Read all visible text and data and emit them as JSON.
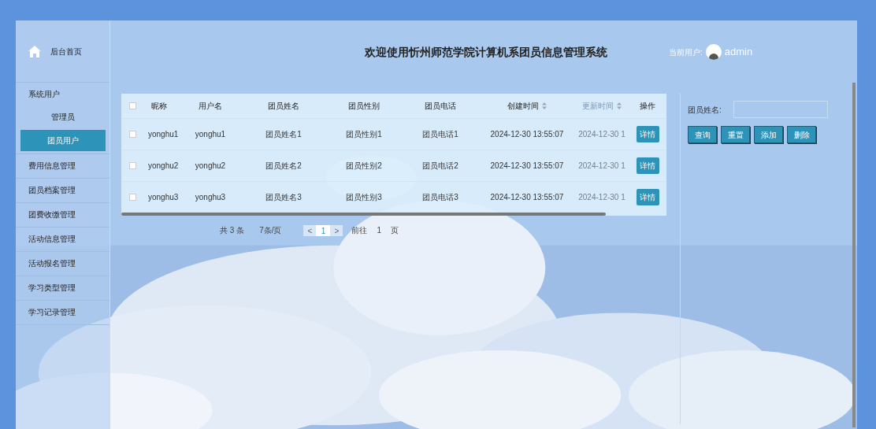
{
  "sidebar": {
    "home": {
      "label": "后台首页"
    },
    "items": [
      {
        "label": "系统用户",
        "selected": false,
        "children": [
          {
            "label": "管理员",
            "selected": false
          },
          {
            "label": "团员用户",
            "selected": true
          }
        ]
      },
      {
        "label": "费用信息管理",
        "selected": false
      },
      {
        "label": "团员档案管理",
        "selected": false
      },
      {
        "label": "团费收缴管理",
        "selected": false
      },
      {
        "label": "活动信息管理",
        "selected": false
      },
      {
        "label": "活动报名管理",
        "selected": false
      },
      {
        "label": "学习类型管理",
        "selected": false
      },
      {
        "label": "学习记录管理",
        "selected": false
      }
    ]
  },
  "header": {
    "title": "欢迎使用忻州师范学院计算机系团员信息管理系统",
    "user_label": "当前用户:",
    "username": "admin"
  },
  "table": {
    "select_all_checked": false,
    "columns": [
      {
        "label": "昵称",
        "sortable": false,
        "faded": false
      },
      {
        "label": "用户名",
        "sortable": false,
        "faded": false
      },
      {
        "label": "团员姓名",
        "sortable": false,
        "faded": false
      },
      {
        "label": "团员性别",
        "sortable": false,
        "faded": false
      },
      {
        "label": "团员电话",
        "sortable": false,
        "faded": false
      },
      {
        "label": "创建时间",
        "sortable": true,
        "faded": false
      },
      {
        "label": "更新时间",
        "sortable": true,
        "faded": true
      },
      {
        "label": "操作",
        "sortable": false,
        "faded": false
      }
    ],
    "rows": [
      {
        "checked": false,
        "cells": [
          "yonghu1",
          "yonghu1",
          "团员姓名1",
          "团员性别1",
          "团员电话1",
          "2024-12-30 13:55:07",
          "2024-12-30 1"
        ],
        "action": "详情"
      },
      {
        "checked": false,
        "cells": [
          "yonghu2",
          "yonghu2",
          "团员姓名2",
          "团员性别2",
          "团员电话2",
          "2024-12-30 13:55:07",
          "2024-12-30 1"
        ],
        "action": "详情"
      },
      {
        "checked": false,
        "cells": [
          "yonghu3",
          "yonghu3",
          "团员姓名3",
          "团员性别3",
          "团员电话3",
          "2024-12-30 13:55:07",
          "2024-12-30 1"
        ],
        "action": "详情"
      }
    ]
  },
  "pagination": {
    "total": "共 3 条",
    "page_size": "7条/页",
    "prev": "<",
    "pages": [
      {
        "label": "1",
        "selected": true
      }
    ],
    "next": ">",
    "goto_label": "前往",
    "goto_value": "1",
    "goto_suffix": "页"
  },
  "search": {
    "label": "团员姓名:",
    "buttons": [
      "查询",
      "重置",
      "添加",
      "删除"
    ]
  }
}
